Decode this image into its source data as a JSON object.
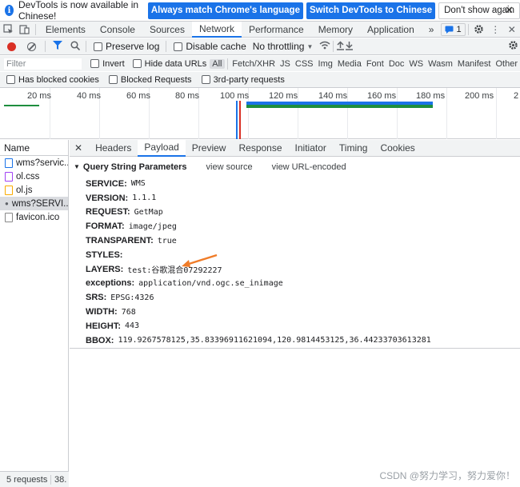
{
  "notice": {
    "message": "DevTools is now available in Chinese!",
    "match_button": "Always match Chrome's language",
    "switch_button": "Switch DevTools to Chinese",
    "dismiss_button": "Don't show again",
    "close": "✕"
  },
  "main_tabs": [
    "Elements",
    "Console",
    "Sources",
    "Network",
    "Performance",
    "Memory",
    "Application"
  ],
  "main_tabs_more": "»",
  "issues_count": "1",
  "toolbar": {
    "preserve_log": "Preserve log",
    "disable_cache": "Disable cache",
    "throttling": "No throttling"
  },
  "filter": {
    "placeholder": "Filter",
    "invert": "Invert",
    "hide_data_urls": "Hide data URLs",
    "types": [
      "All",
      "Fetch/XHR",
      "JS",
      "CSS",
      "Img",
      "Media",
      "Font",
      "Doc",
      "WS",
      "Wasm",
      "Manifest",
      "Other"
    ]
  },
  "blockbar": {
    "blocked_cookies": "Has blocked cookies",
    "blocked_requests": "Blocked Requests",
    "third_party": "3rd-party requests"
  },
  "timeline": {
    "ticks": [
      "20 ms",
      "40 ms",
      "60 ms",
      "80 ms",
      "100 ms",
      "120 ms",
      "140 ms",
      "160 ms",
      "180 ms",
      "200 ms",
      "2"
    ]
  },
  "requests": {
    "header": "Name",
    "items": [
      {
        "name": "wms?servic...",
        "icon": "xhr-doc-icon"
      },
      {
        "name": "ol.css",
        "icon": "css-file-icon"
      },
      {
        "name": "ol.js",
        "icon": "js-file-icon"
      },
      {
        "name": "wms?SERVI...",
        "icon": "image-file-icon"
      },
      {
        "name": "favicon.ico",
        "icon": "file-icon"
      }
    ],
    "summary": "5 requests",
    "summary_extra": "38."
  },
  "detail_tabs": [
    "Headers",
    "Payload",
    "Preview",
    "Response",
    "Initiator",
    "Timing",
    "Cookies"
  ],
  "detail_close": "✕",
  "payload": {
    "section_title": "Query String Parameters",
    "view_source": "view source",
    "view_url_encoded": "view URL-encoded",
    "params": [
      {
        "key": "SERVICE:",
        "value": "WMS"
      },
      {
        "key": "VERSION:",
        "value": "1.1.1"
      },
      {
        "key": "REQUEST:",
        "value": "GetMap"
      },
      {
        "key": "FORMAT:",
        "value": "image/jpeg"
      },
      {
        "key": "TRANSPARENT:",
        "value": "true"
      },
      {
        "key": "STYLES:",
        "value": ""
      },
      {
        "key": "LAYERS:",
        "value": "test:谷歌混合07292227"
      },
      {
        "key": "exceptions:",
        "value": "application/vnd.ogc.se_inimage"
      },
      {
        "key": "SRS:",
        "value": "EPSG:4326"
      },
      {
        "key": "WIDTH:",
        "value": "768"
      },
      {
        "key": "HEIGHT:",
        "value": "443"
      },
      {
        "key": "BBOX:",
        "value": "119.9267578125,35.83396911621094,120.9814453125,36.44233703613281"
      }
    ]
  },
  "watermark": "CSDN @努力学习，努力爱你！",
  "colors": {
    "accent": "#1a73e8",
    "annotation_arrow": "#f07c28",
    "timeline_bar": "#1e8e3e",
    "timeline_bar_top": "#1a73e8"
  }
}
